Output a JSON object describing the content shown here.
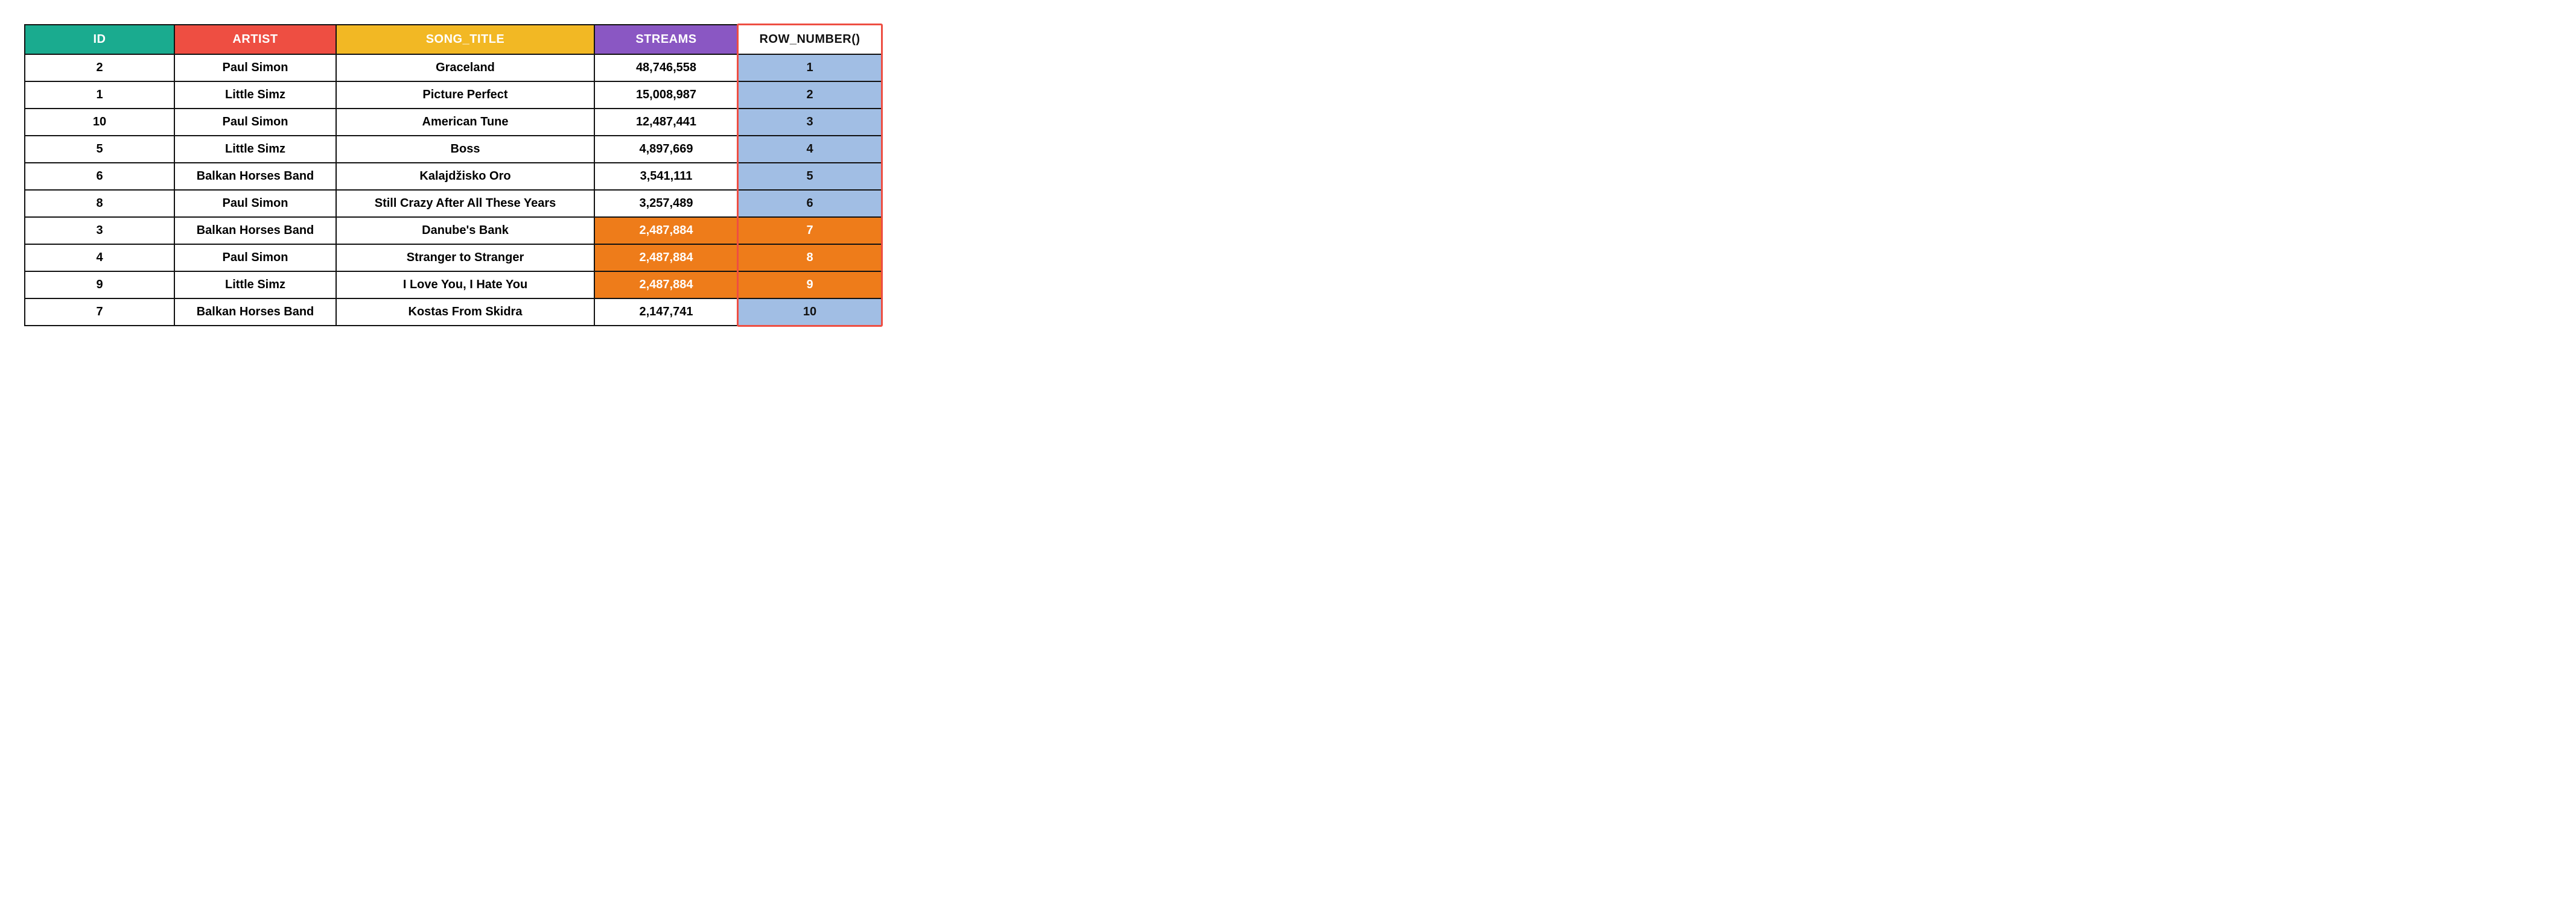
{
  "colors": {
    "teal": "#1aab8f",
    "red": "#ee4e42",
    "yellow": "#f2b824",
    "purple": "#8a57c3",
    "orange": "#ee7c1a",
    "blue": "#a1bee4",
    "black": "#111111",
    "white": "#ffffff"
  },
  "columns": {
    "id": {
      "label": "ID",
      "bg": "teal",
      "fg": "white"
    },
    "artist": {
      "label": "ARTIST",
      "bg": "red",
      "fg": "white"
    },
    "title": {
      "label": "SONG_TITLE",
      "bg": "yellow",
      "fg": "white"
    },
    "streams": {
      "label": "STREAMS",
      "bg": "purple",
      "fg": "white"
    },
    "rownum": {
      "label": "ROW_NUMBER()",
      "bg": "white",
      "fg": "black"
    }
  },
  "highlight_column": "rownum",
  "rows": [
    {
      "id": "2",
      "artist": "Paul Simon",
      "title": "Graceland",
      "streams": "48,746,558",
      "rownum": "1",
      "streams_hl": null,
      "rownum_hl": "blue"
    },
    {
      "id": "1",
      "artist": "Little Simz",
      "title": "Picture Perfect",
      "streams": "15,008,987",
      "rownum": "2",
      "streams_hl": null,
      "rownum_hl": "blue"
    },
    {
      "id": "10",
      "artist": "Paul Simon",
      "title": "American Tune",
      "streams": "12,487,441",
      "rownum": "3",
      "streams_hl": null,
      "rownum_hl": "blue"
    },
    {
      "id": "5",
      "artist": "Little Simz",
      "title": "Boss",
      "streams": "4,897,669",
      "rownum": "4",
      "streams_hl": null,
      "rownum_hl": "blue"
    },
    {
      "id": "6",
      "artist": "Balkan Horses Band",
      "title": "Kalajdžisko Oro",
      "streams": "3,541,111",
      "rownum": "5",
      "streams_hl": null,
      "rownum_hl": "blue"
    },
    {
      "id": "8",
      "artist": "Paul Simon",
      "title": "Still Crazy After All These Years",
      "streams": "3,257,489",
      "rownum": "6",
      "streams_hl": null,
      "rownum_hl": "blue"
    },
    {
      "id": "3",
      "artist": "Balkan Horses Band",
      "title": "Danube's Bank",
      "streams": "2,487,884",
      "rownum": "7",
      "streams_hl": "orange",
      "rownum_hl": "orange"
    },
    {
      "id": "4",
      "artist": "Paul Simon",
      "title": "Stranger to Stranger",
      "streams": "2,487,884",
      "rownum": "8",
      "streams_hl": "orange",
      "rownum_hl": "orange"
    },
    {
      "id": "9",
      "artist": "Little Simz",
      "title": "I Love You, I Hate You",
      "streams": "2,487,884",
      "rownum": "9",
      "streams_hl": "orange",
      "rownum_hl": "orange"
    },
    {
      "id": "7",
      "artist": "Balkan Horses Band",
      "title": "Kostas From Skidra",
      "streams": "2,147,741",
      "rownum": "10",
      "streams_hl": null,
      "rownum_hl": "blue"
    }
  ]
}
